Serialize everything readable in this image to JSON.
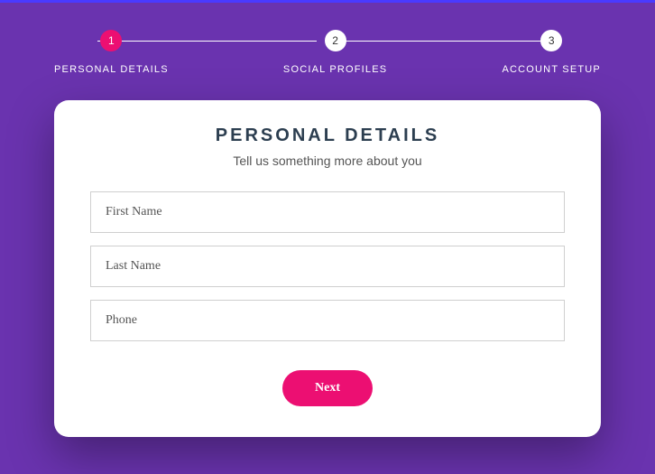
{
  "colors": {
    "background": "#6a33af",
    "accent": "#ec0f72",
    "top_border": "#4a3aff"
  },
  "stepper": {
    "steps": [
      {
        "number": "1",
        "label": "PERSONAL DETAILS",
        "active": true
      },
      {
        "number": "2",
        "label": "SOCIAL PROFILES",
        "active": false
      },
      {
        "number": "3",
        "label": "ACCOUNT SETUP",
        "active": false
      }
    ]
  },
  "card": {
    "title": "PERSONAL DETAILS",
    "subtitle": "Tell us something more about you",
    "fields": [
      {
        "placeholder": "First Name",
        "value": ""
      },
      {
        "placeholder": "Last Name",
        "value": ""
      },
      {
        "placeholder": "Phone",
        "value": ""
      }
    ],
    "next_label": "Next"
  }
}
